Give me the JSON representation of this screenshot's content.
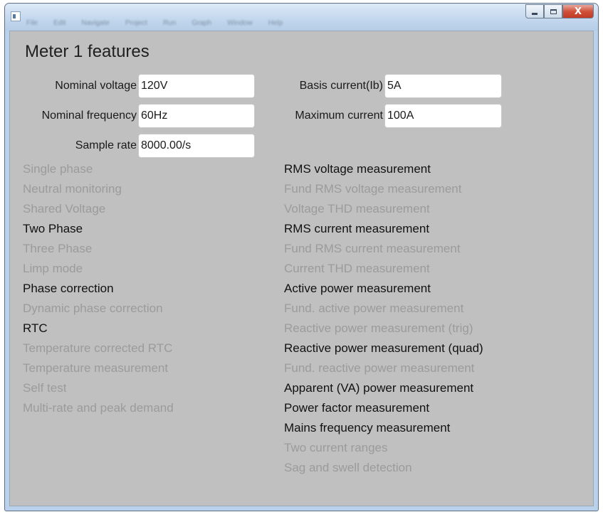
{
  "panel": {
    "title": "Meter 1 features"
  },
  "menu": [
    "File",
    "Edit",
    "Navigate",
    "Project",
    "Run",
    "Graph",
    "Window",
    "Help"
  ],
  "window_controls": {
    "close_glyph": "X"
  },
  "fields": {
    "nominal_voltage": {
      "label": "Nominal voltage",
      "value": "120V"
    },
    "nominal_frequency": {
      "label": "Nominal frequency",
      "value": "60Hz"
    },
    "sample_rate": {
      "label": "Sample rate",
      "value": "8000.00/s"
    },
    "basis_current": {
      "label": "Basis current(Ib)",
      "value": "5A"
    },
    "maximum_current": {
      "label": "Maximum current",
      "value": "100A"
    }
  },
  "features_left": [
    {
      "label": "Single phase",
      "enabled": false
    },
    {
      "label": "Neutral monitoring",
      "enabled": false
    },
    {
      "label": "Shared Voltage",
      "enabled": false
    },
    {
      "label": "Two Phase",
      "enabled": true
    },
    {
      "label": "Three Phase",
      "enabled": false
    },
    {
      "label": "Limp mode",
      "enabled": false
    },
    {
      "label": "Phase correction",
      "enabled": true
    },
    {
      "label": "Dynamic phase correction",
      "enabled": false
    },
    {
      "label": "RTC",
      "enabled": true
    },
    {
      "label": "Temperature corrected RTC",
      "enabled": false
    },
    {
      "label": "Temperature measurement",
      "enabled": false
    },
    {
      "label": "Self test",
      "enabled": false
    },
    {
      "label": "Multi-rate and peak demand",
      "enabled": false
    }
  ],
  "features_right": [
    {
      "label": "RMS voltage measurement",
      "enabled": true
    },
    {
      "label": "Fund RMS voltage measurement",
      "enabled": false
    },
    {
      "label": "Voltage THD measurement",
      "enabled": false
    },
    {
      "label": "RMS current measurement",
      "enabled": true
    },
    {
      "label": "Fund RMS current measurement",
      "enabled": false
    },
    {
      "label": "Current THD measurement",
      "enabled": false
    },
    {
      "label": "Active power measurement",
      "enabled": true
    },
    {
      "label": "Fund. active power measurement",
      "enabled": false
    },
    {
      "label": "Reactive power measurement (trig)",
      "enabled": false
    },
    {
      "label": "Reactive power measurement (quad)",
      "enabled": true
    },
    {
      "label": "Fund. reactive power measurement",
      "enabled": false
    },
    {
      "label": "Apparent (VA) power measurement",
      "enabled": true
    },
    {
      "label": "Power factor measurement",
      "enabled": true
    },
    {
      "label": "Mains frequency measurement",
      "enabled": true
    },
    {
      "label": "Two current ranges",
      "enabled": false
    },
    {
      "label": "Sag and swell detection",
      "enabled": false
    }
  ],
  "colors": {
    "enabled_text": "#111111",
    "disabled_text": "#9b9b9b",
    "panel_background": "#c0c0c0",
    "close_button": "#c9452f"
  }
}
